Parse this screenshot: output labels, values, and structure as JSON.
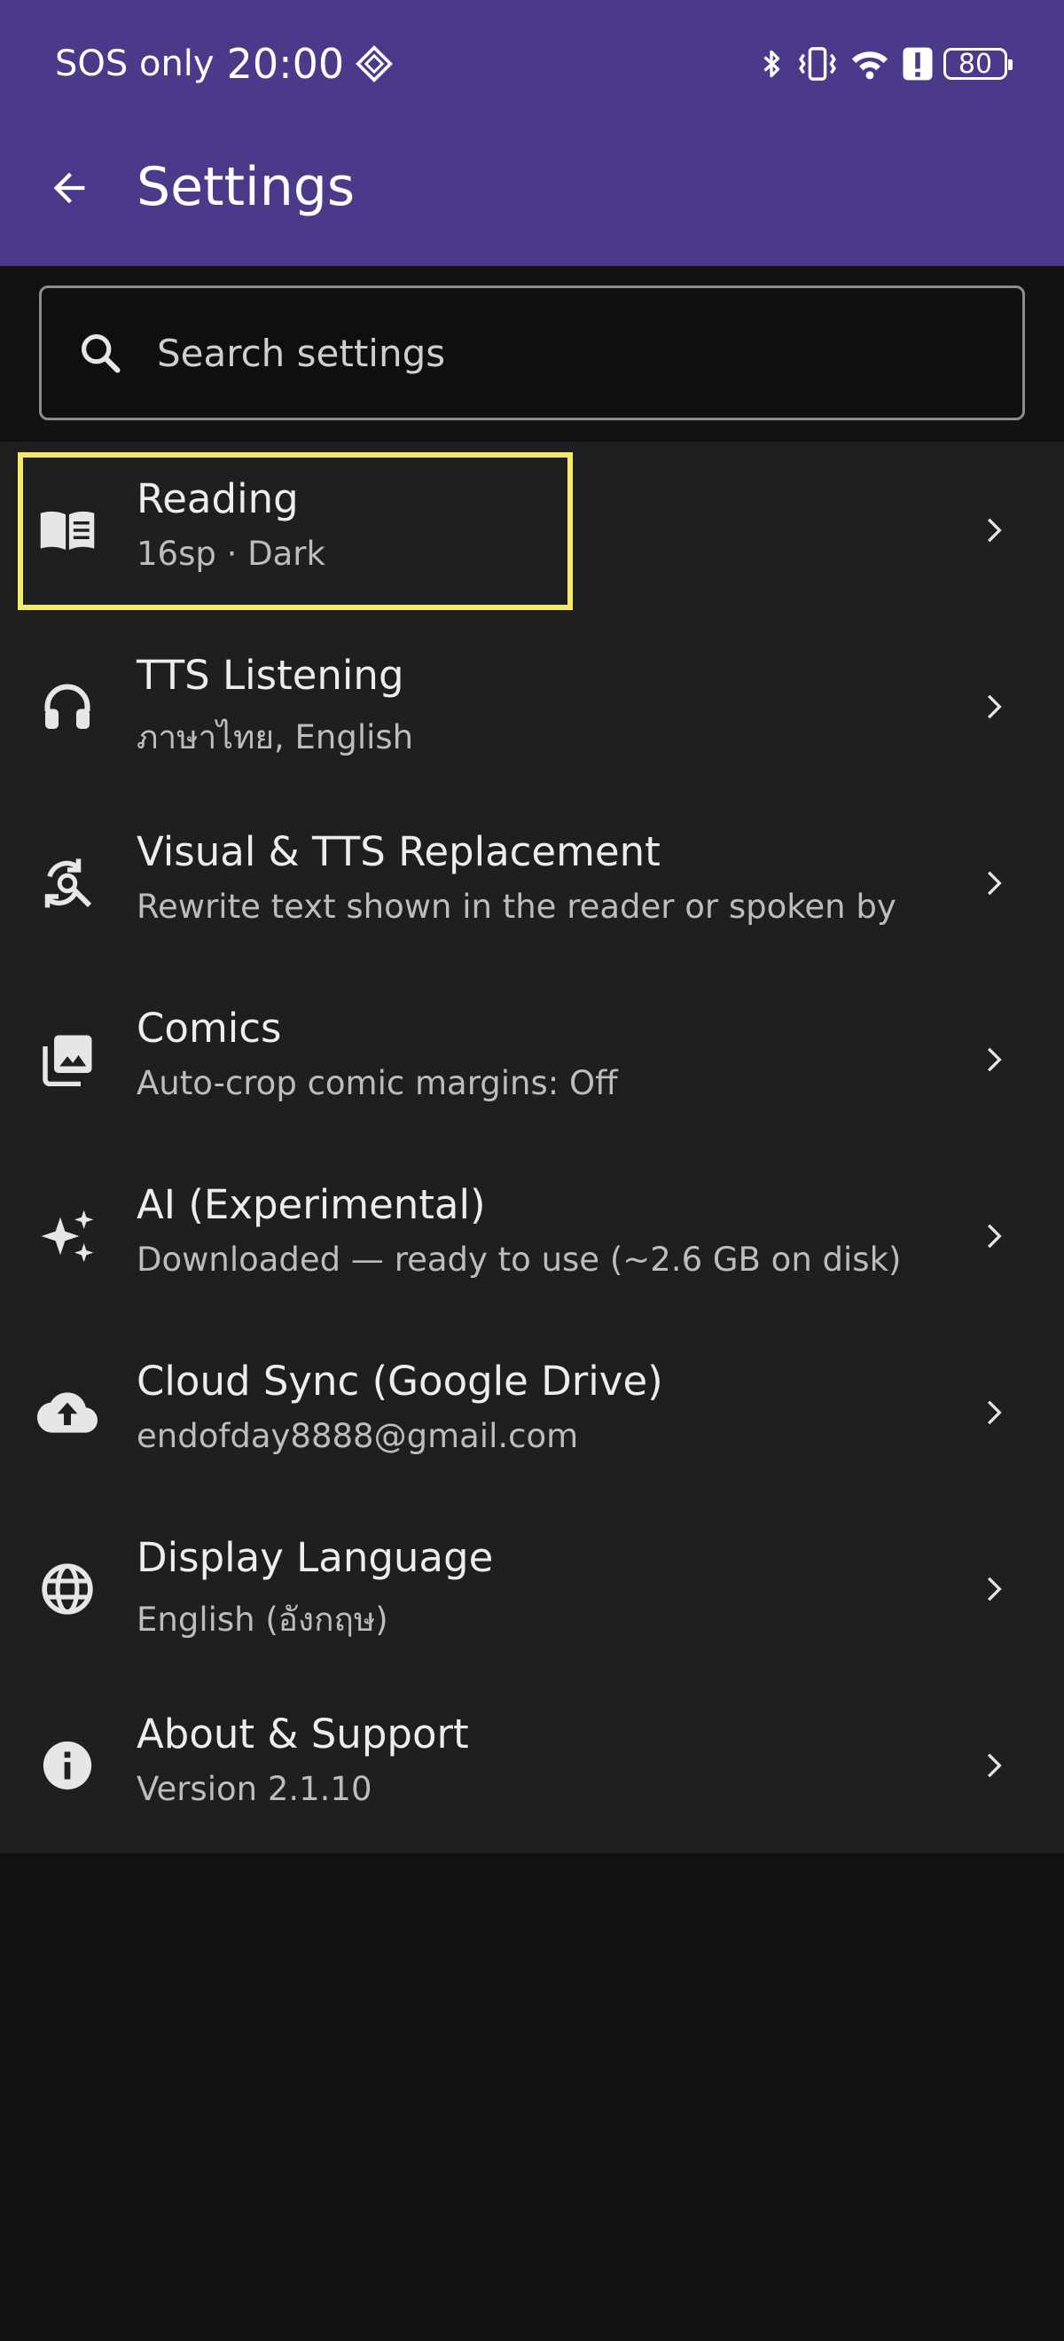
{
  "status_bar": {
    "carrier": "SOS only",
    "time": "20:00",
    "battery": "80"
  },
  "app_bar": {
    "title": "Settings"
  },
  "search": {
    "placeholder": "Search settings"
  },
  "settings": [
    {
      "title": "Reading",
      "subtitle": "16sp · Dark",
      "icon": "book-icon"
    },
    {
      "title": "TTS Listening",
      "subtitle": "ภาษาไทย, English",
      "icon": "headphones-icon"
    },
    {
      "title": "Visual & TTS Replacement",
      "subtitle": "Rewrite text shown in the reader or spoken by",
      "icon": "find-replace-icon"
    },
    {
      "title": "Comics",
      "subtitle": "Auto-crop comic margins: Off",
      "icon": "photo-library-icon"
    },
    {
      "title": "AI (Experimental)",
      "subtitle": "Downloaded — ready to use (~2.6 GB on disk)",
      "icon": "sparkle-icon"
    },
    {
      "title": "Cloud Sync (Google Drive)",
      "subtitle": "endofday8888@gmail.com",
      "icon": "cloud-upload-icon"
    },
    {
      "title": "Display Language",
      "subtitle": "English (อังกฤษ)",
      "icon": "globe-icon"
    },
    {
      "title": "About & Support",
      "subtitle": "Version 2.1.10",
      "icon": "info-icon"
    }
  ],
  "colors": {
    "app_bar": "#4b3a8a",
    "list_background": "#1f1f1f",
    "page_background": "#121212",
    "highlight": "#f3ea6b"
  }
}
